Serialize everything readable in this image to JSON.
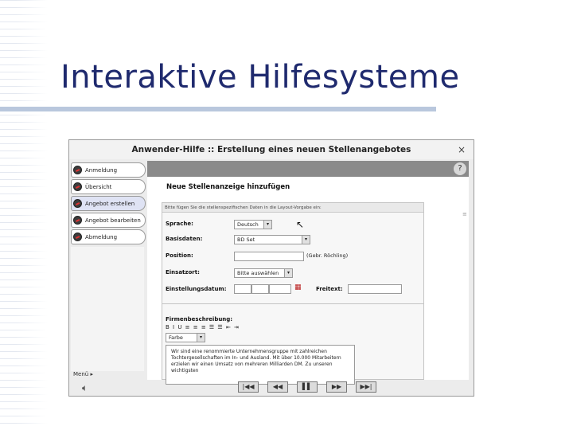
{
  "slide": {
    "title": "Interaktive Hilfesysteme"
  },
  "window": {
    "title": "Anwender-Hilfe :: Erstellung eines neuen Stellenangebotes",
    "close_glyph": "×"
  },
  "nav": {
    "items": [
      {
        "label": "Anmeldung"
      },
      {
        "label": "Übersicht"
      },
      {
        "label": "Angebot erstellen"
      },
      {
        "label": "Angebot bearbeiten"
      },
      {
        "label": "Abmeldung"
      }
    ],
    "menu_label": "Menü ▸"
  },
  "content": {
    "heading": "Neue Stellenanzeige hinzufügen",
    "hint": "Bitte fügen Sie die stellenspezifischen Daten in die Layout-Vorgabe ein:",
    "fields": {
      "sprache": {
        "label": "Sprache:",
        "value": "Deutsch"
      },
      "basisdaten": {
        "label": "Basisdaten:",
        "value": "BD Set"
      },
      "position": {
        "label": "Position:",
        "value": "",
        "note": "(Gebr. Röchling)"
      },
      "einsatzort": {
        "label": "Einsatzort:",
        "value": "Bitte auswählen"
      },
      "einstellungsdatum": {
        "label": "Einstellungsdatum:"
      },
      "freitext": {
        "label": "Freitext:",
        "value": ""
      }
    },
    "firmenbeschreibung": {
      "label": "Firmenbeschreibung:",
      "toolbar": "B I U ≡ ≡ ≡ ☰ ☰ ⇤ ⇥",
      "color_select": "Farbe",
      "text": "Wir sind eine renommierte Unternehmensgruppe mit zahlreichen Tochtergesellschaften im In- und Ausland. Mit über 10.000 Mitarbeitern erzielen wir einen Umsatz von mehreren Milliarden DM. Zu unseren wichtigsten"
    }
  },
  "controls": [
    "|◀◀",
    "◀◀",
    "▌▌",
    "▶▶",
    "▶▶|"
  ],
  "icons": {
    "speaker": "speaker-icon",
    "help": "help-icon",
    "cursor": "cursor-icon",
    "calendar": "calendar-icon"
  }
}
